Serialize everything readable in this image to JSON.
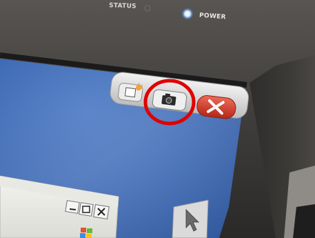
{
  "bezel": {
    "status_label": "STATUS",
    "power_label": "POWER",
    "power_led_color": "#cfe6ff"
  },
  "screen": {
    "toolbar": {
      "buttons": [
        {
          "name": "sun-burst-icon"
        },
        {
          "name": "camera-icon"
        },
        {
          "name": "close-icon"
        }
      ],
      "close_button_color": "#d23a2a"
    },
    "window_controls": [
      {
        "name": "minimize-icon"
      },
      {
        "name": "maximize-icon"
      },
      {
        "name": "close-x-icon"
      }
    ],
    "side_tool": {
      "name": "pointer-arrow-icon"
    }
  },
  "annotation": {
    "highlight_color": "#e00000",
    "target": "camera-button"
  }
}
